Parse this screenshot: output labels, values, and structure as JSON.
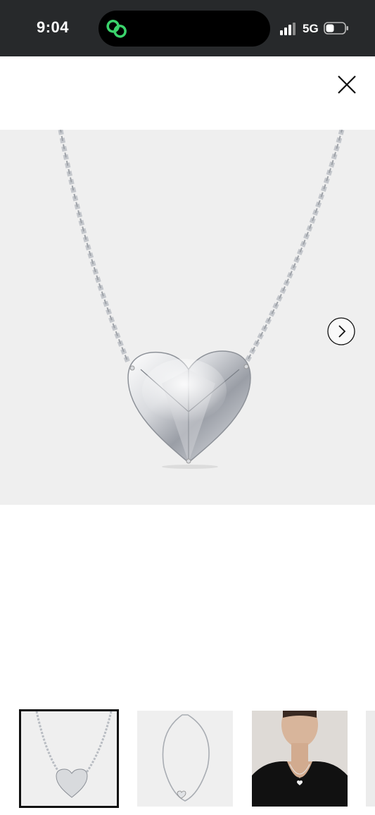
{
  "status_bar": {
    "time": "9:04",
    "network": "5G",
    "icons": [
      "app-link-icon",
      "signal-icon",
      "battery-icon"
    ]
  },
  "header": {
    "close_icon": "close-icon"
  },
  "gallery": {
    "main_image": "heart-diamond-pendant-necklace",
    "next_icon": "chevron-right-icon",
    "thumbnails": [
      {
        "name": "heart-pendant-closeup",
        "selected": true
      },
      {
        "name": "full-necklace-view",
        "selected": false
      },
      {
        "name": "necklace-on-model",
        "selected": false
      },
      {
        "name": "partial-thumbnail",
        "selected": false
      }
    ]
  },
  "colors": {
    "status_bar": "#27292b",
    "image_bg": "#efefef",
    "accent_green": "#3ad36b"
  }
}
